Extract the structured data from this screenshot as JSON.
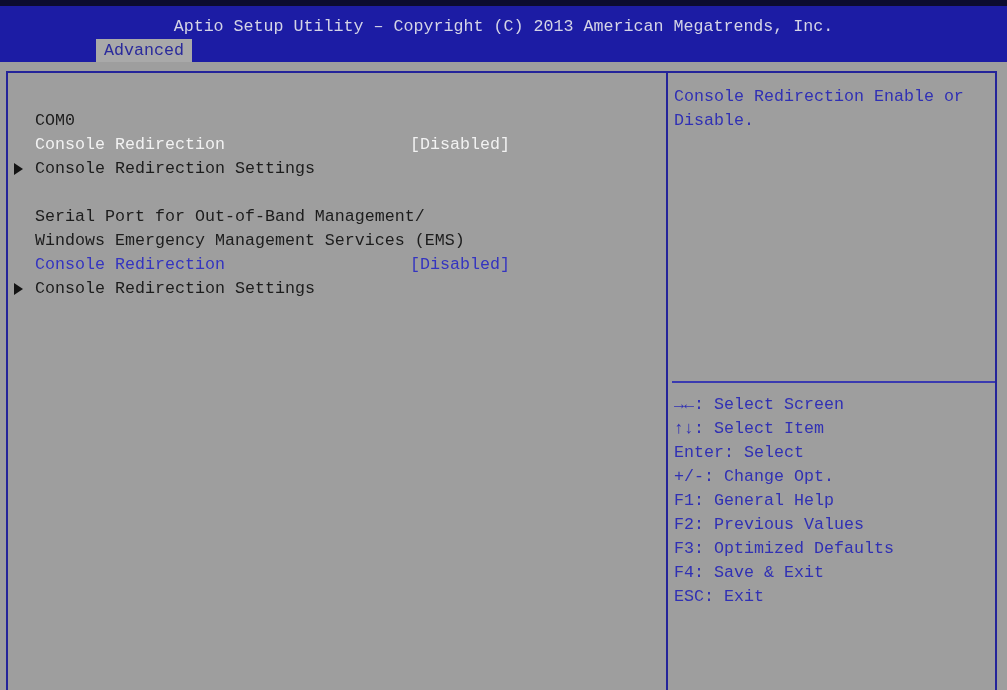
{
  "header": {
    "title": "Aptio Setup Utility – Copyright (C) 2013 American Megatrends, Inc.",
    "tabs": [
      {
        "label": "Advanced",
        "selected": true
      }
    ]
  },
  "menu": {
    "sections": [
      {
        "rows": [
          {
            "kind": "label",
            "text": "COM0"
          },
          {
            "kind": "option",
            "label": "Console Redirection",
            "value": "[Disabled]",
            "selected": true
          },
          {
            "kind": "submenu",
            "label": "Console Redirection Settings"
          }
        ]
      },
      {
        "rows": [
          {
            "kind": "label",
            "text": "Serial Port for Out-of-Band Management/"
          },
          {
            "kind": "label",
            "text": "Windows Emergency Management Services (EMS)"
          },
          {
            "kind": "option",
            "label": "Console Redirection",
            "value": "[Disabled]",
            "selected": false
          },
          {
            "kind": "submenu",
            "label": "Console Redirection Settings"
          }
        ]
      }
    ]
  },
  "help": {
    "text": "Console Redirection Enable or Disable.",
    "hints": [
      "→←: Select Screen",
      "↑↓: Select Item",
      "Enter: Select",
      "+/-: Change Opt.",
      "F1: General Help",
      "F2: Previous Values",
      "F3: Optimized Defaults",
      "F4: Save & Exit",
      "ESC: Exit"
    ]
  }
}
